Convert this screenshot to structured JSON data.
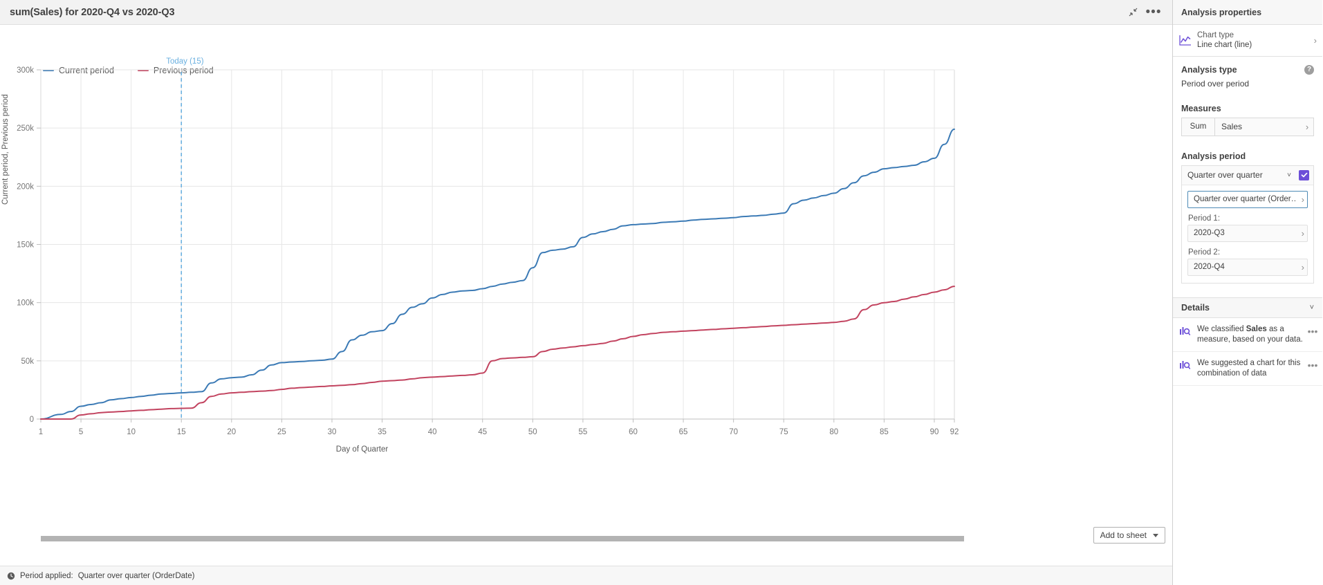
{
  "chart_panel": {
    "title": "sum(Sales) for 2020-Q4 vs 2020-Q3",
    "minimize_icon": "minimize-icon",
    "more_icon": "more-options-icon"
  },
  "status": {
    "clock_icon": "clock-icon",
    "label": "Period applied:",
    "value": "Quarter over quarter (OrderDate)"
  },
  "add_to_sheet": {
    "label": "Add to sheet",
    "caret_icon": "chevron-down-icon"
  },
  "properties": {
    "header": "Analysis properties",
    "chart_type": {
      "icon": "line-chart-icon",
      "label": "Chart type",
      "value": "Line chart (line)",
      "chevron_icon": "chevron-right-icon"
    },
    "analysis_type": {
      "heading": "Analysis type",
      "help_icon": "help-icon",
      "help_glyph": "?",
      "value": "Period over period"
    },
    "measures": {
      "heading": "Measures",
      "aggregation": "Sum",
      "field": "Sales",
      "chevron_icon": "chevron-right-icon"
    },
    "analysis_period": {
      "heading": "Analysis period",
      "selected": "Quarter over quarter",
      "caret_icon": "chevron-down-icon",
      "checkbox_icon": "checkmark-icon",
      "checked": true,
      "definition_button": "Quarter over quarter (Order…",
      "period1_label": "Period 1:",
      "period1_value": "2020-Q3",
      "period2_label": "Period 2:",
      "period2_value": "2020-Q4"
    },
    "details": {
      "heading": "Details",
      "collapse_icon": "chevron-down-icon",
      "items": [
        {
          "icon": "insight-icon",
          "text_before": "We classified ",
          "bold": "Sales",
          "text_after": " as a measure, based on your data.",
          "menu_icon": "more-options-icon"
        },
        {
          "icon": "insight-icon",
          "text_before": "We suggested a chart for this combination of data",
          "bold": "",
          "text_after": "",
          "menu_icon": "more-options-icon"
        }
      ]
    }
  },
  "chart_data": {
    "type": "line",
    "title": "sum(Sales) for 2020-Q4 vs 2020-Q3",
    "xlabel": "Day of Quarter",
    "ylabel": "Current period, Previous period",
    "xlim": [
      1,
      92
    ],
    "ylim": [
      0,
      300000
    ],
    "ytick_labels": [
      "0",
      "50k",
      "100k",
      "150k",
      "200k",
      "250k",
      "300k"
    ],
    "ytick_values": [
      0,
      50000,
      100000,
      150000,
      200000,
      250000,
      300000
    ],
    "xtick_labels": [
      "1",
      "5",
      "10",
      "15",
      "20",
      "25",
      "30",
      "35",
      "40",
      "45",
      "50",
      "55",
      "60",
      "65",
      "70",
      "75",
      "80",
      "85",
      "90",
      "92"
    ],
    "xtick_values": [
      1,
      5,
      10,
      15,
      20,
      25,
      30,
      35,
      40,
      45,
      50,
      55,
      60,
      65,
      70,
      75,
      80,
      85,
      90,
      92
    ],
    "grid": true,
    "legend_position": "top-left",
    "annotations": [
      {
        "name": "today-marker",
        "label": "Today (15)",
        "x": 15,
        "color": "#6ab0e0",
        "style": "dashed-vertical"
      }
    ],
    "series": [
      {
        "name": "Current period",
        "color": "#3b7ab5",
        "x": [
          1,
          3,
          4,
          5,
          6,
          7,
          8,
          9,
          10,
          11,
          12,
          13,
          14,
          15,
          16,
          17,
          18,
          19,
          20,
          21,
          22,
          23,
          24,
          25,
          26,
          27,
          28,
          29,
          30,
          31,
          32,
          33,
          34,
          35,
          36,
          37,
          38,
          39,
          40,
          41,
          42,
          43,
          44,
          45,
          46,
          47,
          48,
          49,
          50,
          51,
          52,
          53,
          54,
          55,
          56,
          57,
          58,
          59,
          60,
          61,
          62,
          63,
          64,
          65,
          66,
          67,
          68,
          69,
          70,
          71,
          72,
          73,
          74,
          75,
          76,
          77,
          78,
          79,
          80,
          81,
          82,
          83,
          84,
          85,
          86,
          87,
          88,
          89,
          90,
          91,
          92
        ],
        "y": [
          0,
          4000,
          6500,
          11000,
          12500,
          14000,
          16500,
          17500,
          18500,
          19500,
          20500,
          21500,
          22000,
          22500,
          23000,
          23500,
          31000,
          34500,
          35500,
          36000,
          38000,
          42000,
          46500,
          48500,
          49000,
          49500,
          50000,
          50500,
          51500,
          58000,
          68000,
          72000,
          75000,
          76000,
          82000,
          90000,
          96000,
          99000,
          104000,
          107000,
          109000,
          110000,
          110500,
          112000,
          114000,
          116000,
          117500,
          119000,
          130000,
          143000,
          145000,
          146000,
          148000,
          156000,
          159000,
          161000,
          163000,
          166000,
          167000,
          167500,
          168000,
          169000,
          169500,
          170000,
          171000,
          171500,
          172000,
          172500,
          173000,
          174000,
          174500,
          175000,
          176000,
          177000,
          185000,
          188000,
          190000,
          192000,
          194000,
          198000,
          203000,
          209000,
          212000,
          215000,
          216000,
          217000,
          218000,
          221000,
          224000,
          236000,
          249000
        ]
      },
      {
        "name": "Previous period",
        "color": "#c2435f",
        "x": [
          1,
          2,
          3,
          4,
          5,
          6,
          7,
          8,
          9,
          10,
          11,
          12,
          13,
          14,
          15,
          16,
          17,
          18,
          19,
          20,
          21,
          22,
          23,
          24,
          25,
          26,
          27,
          28,
          29,
          30,
          31,
          32,
          33,
          34,
          35,
          36,
          37,
          38,
          39,
          40,
          41,
          42,
          43,
          44,
          45,
          46,
          47,
          48,
          49,
          50,
          51,
          52,
          53,
          54,
          55,
          56,
          57,
          58,
          59,
          60,
          61,
          62,
          63,
          64,
          65,
          66,
          67,
          68,
          69,
          70,
          71,
          72,
          73,
          74,
          75,
          76,
          77,
          78,
          79,
          80,
          81,
          82,
          83,
          84,
          85,
          86,
          87,
          88,
          89,
          90,
          91,
          92
        ],
        "y": [
          0,
          0,
          0,
          0,
          3500,
          4500,
          5500,
          6000,
          6500,
          7000,
          7500,
          8000,
          8500,
          9000,
          9200,
          9400,
          14000,
          19500,
          21500,
          22500,
          23000,
          23500,
          24000,
          24500,
          25500,
          26500,
          27000,
          27500,
          28000,
          28500,
          29000,
          29500,
          30500,
          31500,
          32500,
          33000,
          33500,
          34500,
          35500,
          36000,
          36500,
          37000,
          37500,
          38000,
          39500,
          50000,
          52000,
          52500,
          53000,
          53500,
          58000,
          60000,
          61000,
          62000,
          63000,
          64000,
          65000,
          67000,
          69000,
          71000,
          72500,
          73500,
          74500,
          75000,
          75500,
          76000,
          76500,
          77000,
          77500,
          78000,
          78500,
          79000,
          79500,
          80000,
          80500,
          81000,
          81500,
          82000,
          82500,
          83000,
          84000,
          86000,
          94000,
          98000,
          100000,
          101000,
          103000,
          105000,
          107000,
          109000,
          111000,
          114000
        ]
      }
    ]
  }
}
